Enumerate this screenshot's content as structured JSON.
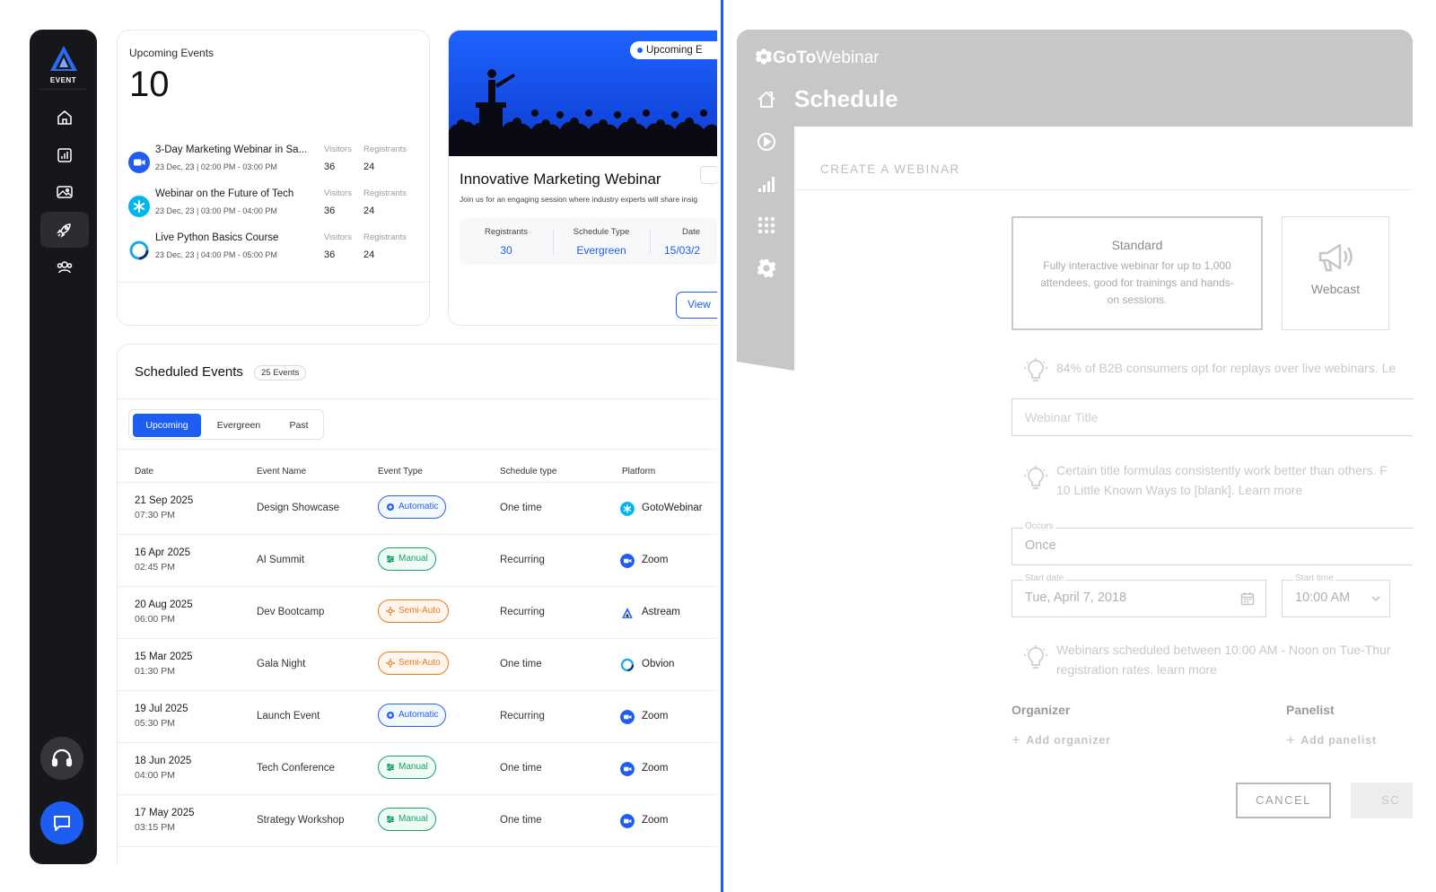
{
  "sidebar": {
    "logo_text": "EVENT",
    "nav": [
      "home-icon",
      "chart-icon",
      "image-icon",
      "rocket-icon",
      "users-icon"
    ],
    "active_index": 3
  },
  "upcoming": {
    "label": "Upcoming Events",
    "count": "10",
    "visitors_label": "Visitors",
    "registrants_label": "Registrants",
    "events": [
      {
        "title": "3-Day Marketing Webinar in Sa...",
        "time": "23 Dec, 23 | 02:00 PM - 03:00 PM",
        "visitors": "36",
        "registrants": "24",
        "icon": "zoom-icon"
      },
      {
        "title": "Webinar on the Future of Tech",
        "time": "23 Dec, 23 | 03:00 PM - 04:00 PM",
        "visitors": "36",
        "registrants": "24",
        "icon": "gotowebinar-icon"
      },
      {
        "title": "Live Python Basics Course",
        "time": "23 Dec, 23 | 04:00 PM - 05:00 PM",
        "visitors": "36",
        "registrants": "24",
        "icon": "obvion-icon"
      }
    ]
  },
  "webinar": {
    "badge": "Upcoming E",
    "title": "Innovative Marketing Webinar",
    "desc": "Join us for an engaging session where industry experts will share insig",
    "stats": [
      {
        "label": "Registrants",
        "value": "30"
      },
      {
        "label": "Schedule Type",
        "value": "Evergreen"
      },
      {
        "label": "Date",
        "value": "15/03/2"
      }
    ],
    "view_label": "View"
  },
  "scheduled": {
    "title": "Scheduled Events",
    "count": "25 Events",
    "tabs": [
      "Upcoming",
      "Evergreen",
      "Past"
    ],
    "active_tab": 0,
    "columns": [
      "Date",
      "Event Name",
      "Event Type",
      "Schedule type",
      "Platform"
    ],
    "rows": [
      {
        "date": "21 Sep 2025",
        "time": "07:30 PM",
        "name": "Design Showcase",
        "type": "Automatic",
        "schedule": "One time",
        "platform": "GotoWebinar"
      },
      {
        "date": "16 Apr 2025",
        "time": "02:45 PM",
        "name": "AI Summit",
        "type": "Manual",
        "schedule": "Recurring",
        "platform": "Zoom"
      },
      {
        "date": "20 Aug 2025",
        "time": "06:00 PM",
        "name": "Dev Bootcamp",
        "type": "Semi-Auto",
        "schedule": "Recurring",
        "platform": "Astream"
      },
      {
        "date": "15 Mar 2025",
        "time": "01:30 PM",
        "name": "Gala Night",
        "type": "Semi-Auto",
        "schedule": "One time",
        "platform": "Obvion"
      },
      {
        "date": "19 Jul 2025",
        "time": "05:30 PM",
        "name": "Launch Event",
        "type": "Automatic",
        "schedule": "Recurring",
        "platform": "Zoom"
      },
      {
        "date": "18 Jun 2025",
        "time": "04:00 PM",
        "name": "Tech Conference",
        "type": "Manual",
        "schedule": "One time",
        "platform": "Zoom"
      },
      {
        "date": "17 May 2025",
        "time": "03:15 PM",
        "name": "Strategy Workshop",
        "type": "Manual",
        "schedule": "One time",
        "platform": "Zoom"
      }
    ]
  },
  "gtw": {
    "brand_bold": "GoTo",
    "brand_light": "Webinar",
    "page_title": "Schedule",
    "create_label": "CREATE A WEBINAR",
    "standard_title": "Standard",
    "standard_desc": "Fully interactive webinar for up to 1,000 attendees, good for trainings and hands-on sessions.",
    "webcast_title": "Webcast",
    "tip1": "84% of B2B consumers opt for replays over live webinars. Le",
    "title_placeholder": "Webinar Title",
    "tip2_l1": "Certain title formulas consistently work better than others. F",
    "tip2_l2": "10 Little Known Ways to [blank]. Learn more",
    "occurs_label": "Occurs",
    "occurs_value": "Once",
    "start_date_label": "Start date",
    "start_date_value": "Tue, April 7, 2018",
    "start_time_label": "Start time",
    "start_time_value": "10:00 AM",
    "tip3_l1": "Webinars scheduled between 10:00 AM - Noon on Tue-Thur",
    "tip3_l2": "registration rates. learn more",
    "organizer_label": "Organizer",
    "add_organizer": "Add organizer",
    "panelist_label": "Panelist",
    "add_panelist": "Add panelist",
    "cancel_label": "CANCEL",
    "schedule_label": "SC"
  },
  "colors": {
    "accent": "#1d5df2",
    "automatic": "#2563eb",
    "manual": "#14a36b",
    "semi_auto": "#f07a16"
  }
}
